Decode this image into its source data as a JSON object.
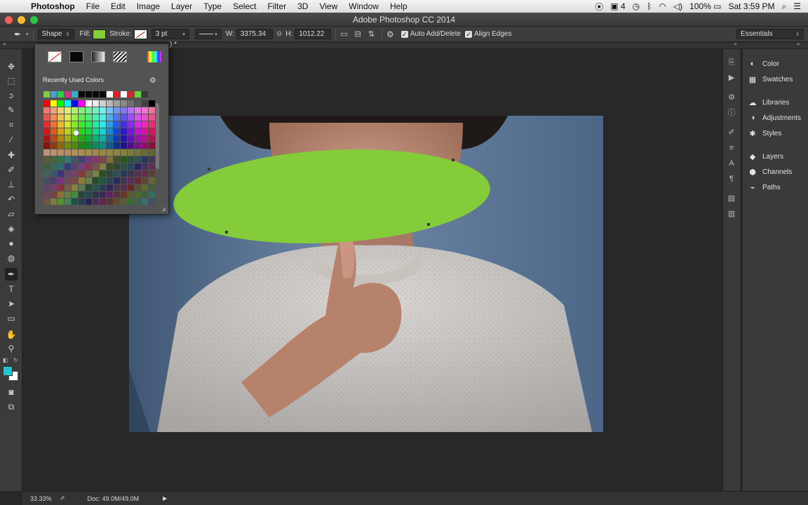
{
  "menubar": {
    "app": "Photoshop",
    "items": [
      "File",
      "Edit",
      "Image",
      "Layer",
      "Type",
      "Select",
      "Filter",
      "3D",
      "View",
      "Window",
      "Help"
    ],
    "status_right": {
      "battery": "100%",
      "clock": "Sat 3:59 PM",
      "badge": "4"
    }
  },
  "window": {
    "title": "Adobe Photoshop CC 2014"
  },
  "options": {
    "mode": "Shape",
    "fill_label": "Fill:",
    "fill_color": "#84cc3a",
    "stroke_label": "Stroke:",
    "stroke_width": "3 pt",
    "w_label": "W:",
    "w_value": "3375.34",
    "h_label": "H:",
    "h_value": "1012.22",
    "auto_add_delete": "Auto Add/Delete",
    "align_edges": "Align Edges",
    "workspace": "Essentials"
  },
  "doc_tab_fragment": ") *",
  "swatch_popup": {
    "recent_label": "Recently Used Colors",
    "recent_colors": [
      "#84cc3a",
      "#4f9bd4",
      "#2ed33a",
      "#c63a86",
      "#2fb2c8",
      "#0a0a0a",
      "#0a0a0a",
      "#0a0a0a",
      "#0a0a0a",
      "#ffffff",
      "#e51e24",
      "#ffffff",
      "#d32828",
      "#6ad339",
      "#3a3a3a"
    ]
  },
  "panels": {
    "items": [
      {
        "icon": "color-icon",
        "label": "Color"
      },
      {
        "icon": "swatches-icon",
        "label": "Swatches"
      },
      {
        "icon": "libraries-icon",
        "label": "Libraries"
      },
      {
        "icon": "adjustments-icon",
        "label": "Adjustments"
      },
      {
        "icon": "styles-icon",
        "label": "Styles"
      },
      {
        "icon": "layers-icon",
        "label": "Layers"
      },
      {
        "icon": "channels-icon",
        "label": "Channels"
      },
      {
        "icon": "paths-icon",
        "label": "Paths"
      }
    ]
  },
  "status": {
    "zoom": "33.33%",
    "doc": "Doc: 49.0M/49.0M"
  },
  "colors": {
    "foreground": "#22c5d4",
    "background": "#ffffff",
    "shape_fill": "#84cc3a"
  }
}
